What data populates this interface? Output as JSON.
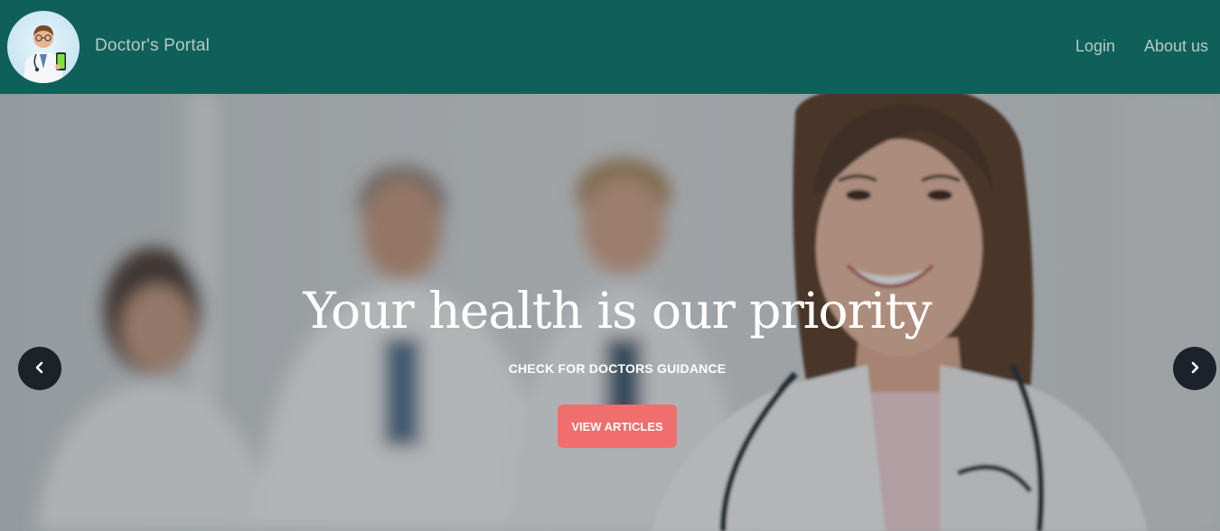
{
  "navbar": {
    "brand": "Doctor's Portal",
    "links": [
      {
        "label": "Login"
      },
      {
        "label": "About us"
      }
    ],
    "background": "#0f605a"
  },
  "hero": {
    "title": "Your health is our priority",
    "subtitle": "CHECK FOR DOCTORS GUIDANCE",
    "button_label": "VIEW ARTICLES",
    "button_color": "#f16e6e",
    "prev_icon": "chevron-left-icon",
    "next_icon": "chevron-right-icon",
    "prev_glyph": "‹",
    "next_glyph": "›"
  }
}
